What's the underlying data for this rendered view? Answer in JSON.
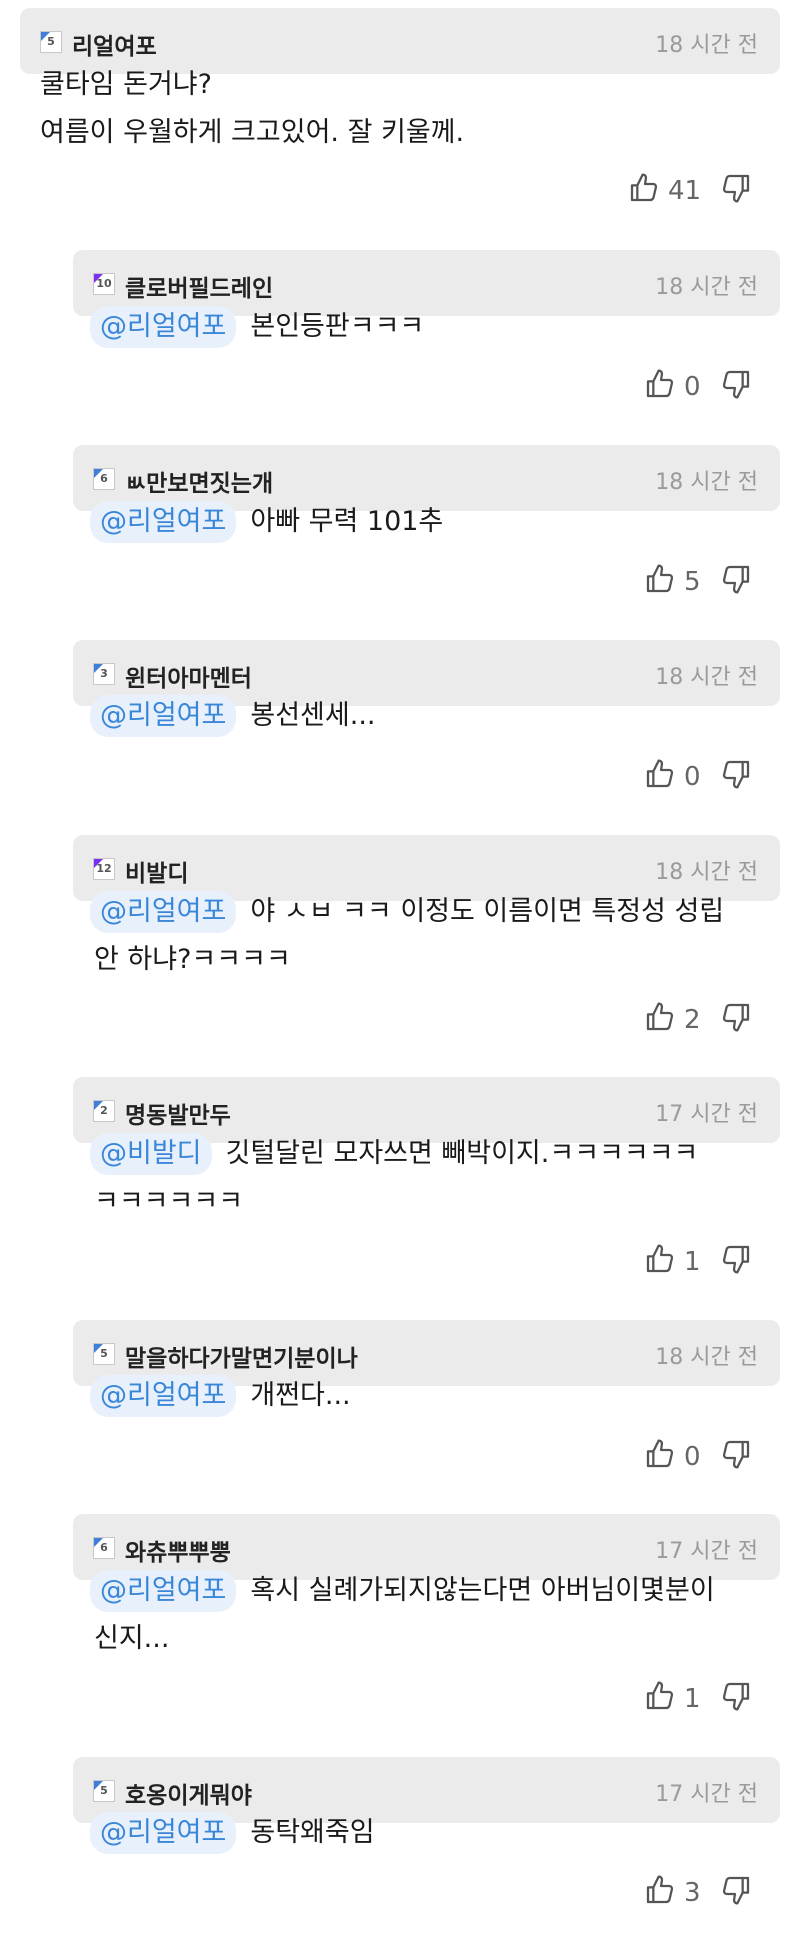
{
  "comments": [
    {
      "author": "리얼여포",
      "badge": "5",
      "badge_color": "#3f7fd8",
      "time": "18 시간 전",
      "mention": "",
      "text_lines": [
        "쿨타임 돈거냐?",
        "여름이 우월하게 크고있어. 잘 키울께."
      ],
      "likes": "41"
    },
    {
      "author": "클로버필드레인",
      "badge": "10",
      "badge_color": "#7b2ff0",
      "time": "18 시간 전",
      "mention": "@리얼여포",
      "text_lines": [
        "본인등판ㅋㅋㅋ"
      ],
      "likes": "0"
    },
    {
      "author": "ㅄ만보면짓는개",
      "badge": "6",
      "badge_color": "#3f7fd8",
      "time": "18 시간 전",
      "mention": "@리얼여포",
      "text_lines": [
        "아빠 무력 101추"
      ],
      "likes": "5"
    },
    {
      "author": "윈터아마멘터",
      "badge": "3",
      "badge_color": "#3f7fd8",
      "time": "18 시간 전",
      "mention": "@리얼여포",
      "text_lines": [
        "봉선센세..."
      ],
      "likes": "0"
    },
    {
      "author": "비발디",
      "badge": "12",
      "badge_color": "#7b2ff0",
      "time": "18 시간 전",
      "mention": "@리얼여포",
      "text_lines": [
        "야 ㅅㅂ ㅋㅋ 이정도 이름이면 특정성 성립",
        "안 하냐?ㅋㅋㅋㅋ"
      ],
      "likes": "2"
    },
    {
      "author": "명동발만두",
      "badge": "2",
      "badge_color": "#3f7fd8",
      "time": "17 시간 전",
      "mention": "@비발디",
      "text_lines": [
        "깃털달린 모자쓰면 빼박이지.ㅋㅋㅋㅋㅋㅋ",
        "ㅋㅋㅋㅋㅋㅋ"
      ],
      "likes": "1"
    },
    {
      "author": "말을하다가말면기분이나",
      "badge": "5",
      "badge_color": "#3f7fd8",
      "time": "18 시간 전",
      "mention": "@리얼여포",
      "text_lines": [
        "개쩐다..."
      ],
      "likes": "0"
    },
    {
      "author": "와츄뿌뿌뿡",
      "badge": "6",
      "badge_color": "#3f7fd8",
      "time": "17 시간 전",
      "mention": "@리얼여포",
      "text_lines": [
        "혹시 실례가되지않는다면 아버님이몇분이",
        "신지..."
      ],
      "likes": "1"
    },
    {
      "author": "호옹이게뭐야",
      "badge": "5",
      "badge_color": "#3f7fd8",
      "time": "17 시간 전",
      "mention": "@리얼여포",
      "text_lines": [
        "동탁왜죽임"
      ],
      "likes": "3"
    }
  ]
}
